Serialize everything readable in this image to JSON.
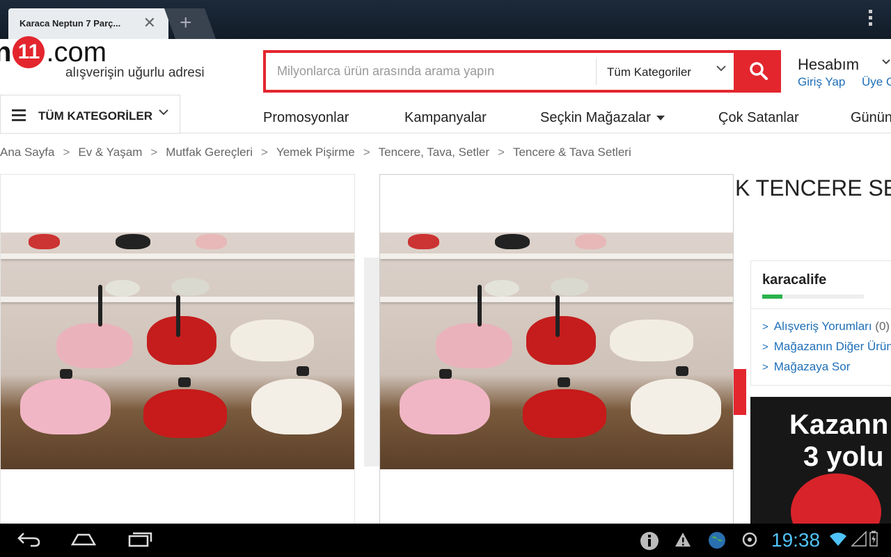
{
  "browser": {
    "tab_title": "Karaca Neptun 7 Parç...",
    "tab_close": "✕",
    "new_tab": "+"
  },
  "header": {
    "logo_n": "n",
    "logo_11": "11",
    "logo_com": ".com",
    "tagline": "alışverişin uğurlu adresi",
    "search_placeholder": "Milyonlarca ürün arasında arama yapın",
    "search_category": "Tüm Kategoriler",
    "account_label": "Hesabım",
    "login": "Giriş Yap",
    "register": "Üye Ol"
  },
  "nav": {
    "all_categories": "TÜM KATEGORİLER",
    "items": [
      "Promosyonlar",
      "Kampanyalar",
      "Seçkin Mağazalar",
      "Çok Satanlar",
      "Günün"
    ]
  },
  "breadcrumb": [
    "Ana Sayfa",
    "Ev & Yaşam",
    "Mutfak Gereçleri",
    "Yemek Pişirme",
    "Tencere, Tava, Setler",
    "Tencere & Tava Setleri"
  ],
  "product": {
    "title_fragment": "K TENCERE SET"
  },
  "store": {
    "name": "karacalife",
    "rating_fraction": 0.2,
    "links": [
      {
        "label": "Alışveriş Yorumları",
        "count": "(0)"
      },
      {
        "label": "Mağazanın Diğer Ürün",
        "count": ""
      },
      {
        "label": "Mağazaya Sor",
        "count": ""
      }
    ]
  },
  "promo": {
    "line1": "Kazann",
    "line2": "3 yolu"
  },
  "system": {
    "time": "19:38"
  },
  "colors": {
    "brand_red": "#e3262e",
    "link_blue": "#1f6fb8",
    "clock_blue": "#4fc3f7"
  }
}
